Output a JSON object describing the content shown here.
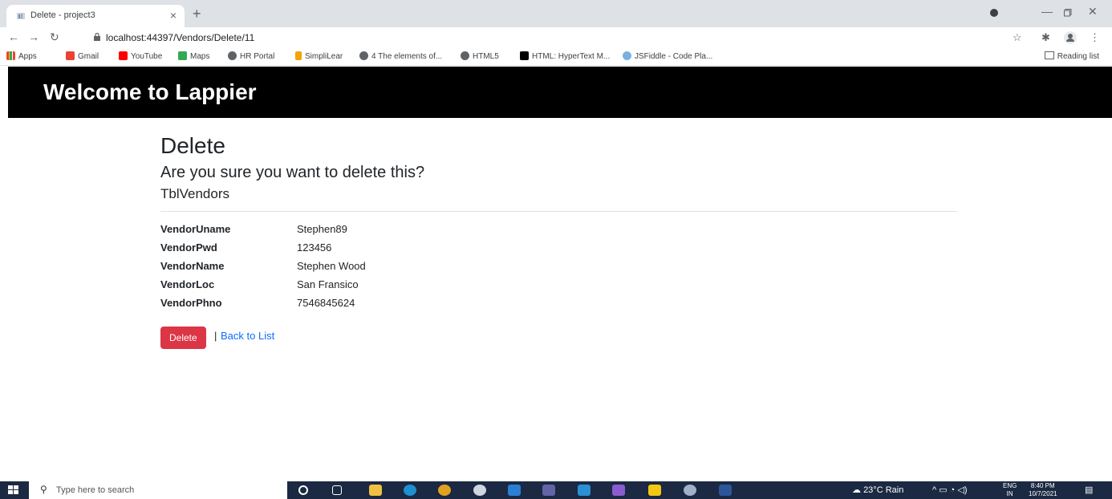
{
  "browser": {
    "tab_title": "Delete - project3",
    "new_tab": "+",
    "close_tab": "×",
    "url": "localhost:44397/Vendors/Delete/11",
    "bookmarks": [
      "Apps",
      "Gmail",
      "YouTube",
      "Maps",
      "HR Portal",
      "SimpliLear",
      "4 The elements of...",
      "HTML5",
      "HTML: HyperText M...",
      "JSFiddle - Code Pla..."
    ],
    "reading_list": "Reading list"
  },
  "site": {
    "header_title": "Welcome to Lappier"
  },
  "page": {
    "heading": "Delete",
    "confirm_text": "Are you sure you want to delete this?",
    "entity_name": "TblVendors",
    "fields": [
      {
        "label": "VendorUname",
        "value": "Stephen89"
      },
      {
        "label": "VendorPwd",
        "value": "123456"
      },
      {
        "label": "VendorName",
        "value": "Stephen Wood"
      },
      {
        "label": "VendorLoc",
        "value": "San Fransico"
      },
      {
        "label": "VendorPhno",
        "value": "7546845624"
      }
    ],
    "delete_button": "Delete",
    "separator": "|",
    "back_link": "Back to List"
  },
  "taskbar": {
    "search_placeholder": "Type here to search",
    "weather": "23°C Rain",
    "language": "ENG",
    "region": "IN",
    "time": "8:40 PM",
    "date": "10/7/2021"
  },
  "colors": {
    "header_bg": "#000000",
    "danger": "#dc3545",
    "link": "#0d6efd",
    "taskbar": "#1b2942"
  }
}
